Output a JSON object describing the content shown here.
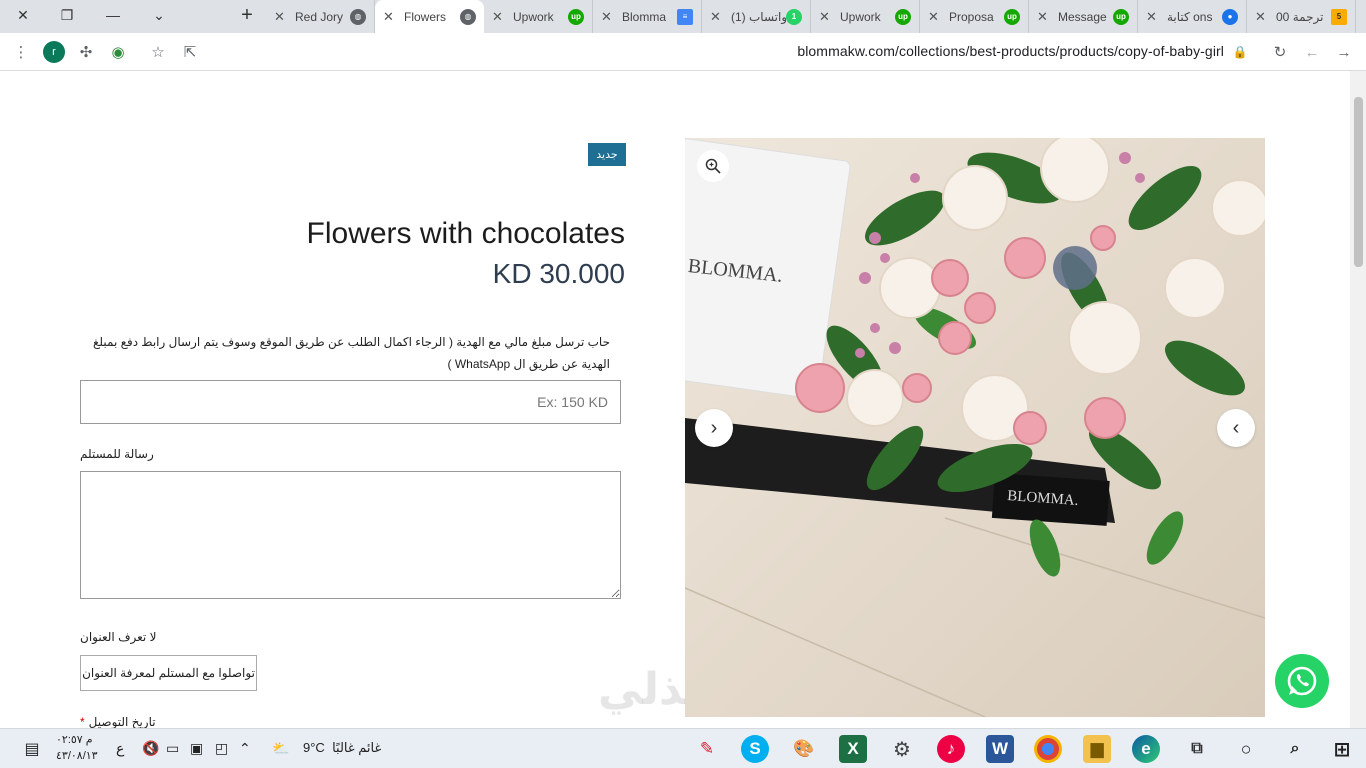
{
  "browser": {
    "tabs": [
      {
        "title": "Red Jory",
        "icon": "globe-icon"
      },
      {
        "title": "Flowers",
        "icon": "globe-icon",
        "active": true
      },
      {
        "title": "Upwork",
        "icon": "upwork-icon"
      },
      {
        "title": "Blomma",
        "icon": "docs-icon"
      },
      {
        "title": "(1) واتساب",
        "icon": "whatsapp-icon"
      },
      {
        "title": "Upwork",
        "icon": "upwork-icon"
      },
      {
        "title": "Proposa",
        "icon": "upwork-icon"
      },
      {
        "title": "Message",
        "icon": "upwork-icon"
      },
      {
        "title": "كتابة ons",
        "icon": "circle-icon"
      },
      {
        "title": "ترجمة 00",
        "icon": "five-icon"
      }
    ],
    "new_tab_label": "+",
    "profile_initial": "r",
    "url": "blommakw.com/collections/best-products/products/copy-of-baby-girl"
  },
  "product": {
    "badge": "جديد",
    "title": "Flowers with chocolates",
    "price": "KD 30.000",
    "gift_label": "حاب ترسل مبلغ مالي مع الهدية ( الرجاء اكمال الطلب عن طريق الموقع وسوف يتم ارسال رابط دفع بمبلغ الهدية عن طريق ال WhatsApp )",
    "gift_placeholder": "Ex: 150 KD",
    "message_label": "رسالة للمستلم",
    "address_label": "لا تعرف العنوان",
    "address_button": "تواصلوا مع المستلم لمعرفة العنوان",
    "date_label": "تاريخ التوصيل",
    "date_required": "*"
  },
  "watermark": "نفذلي",
  "taskbar": {
    "clock_time": "م ٠٢:٥٧",
    "clock_date": "٤٣/٠٨/١٣",
    "lang": "ع",
    "weather_temp": "9°C",
    "weather_text": "غائم غالبًا"
  }
}
